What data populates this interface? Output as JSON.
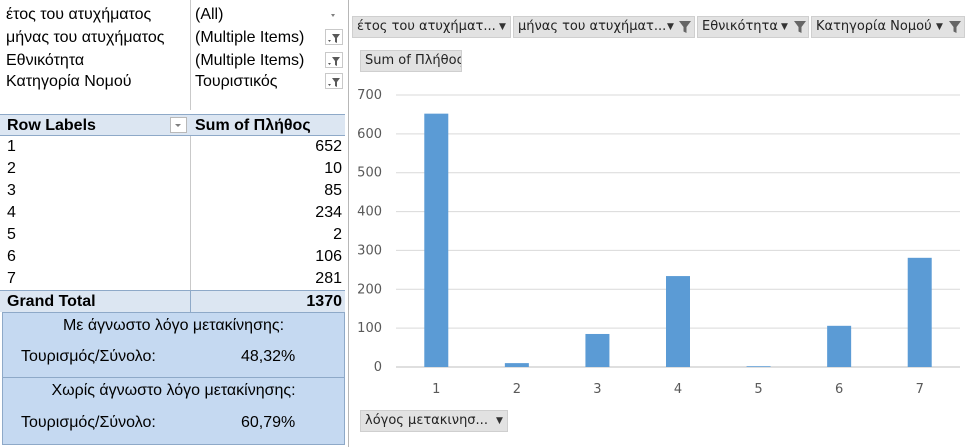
{
  "filters": [
    {
      "name": "έτος του ατυχήματος",
      "value": "(All)",
      "icon": "dropdown-arrow-icon"
    },
    {
      "name": "μήνας του ατυχήματος",
      "value": "(Multiple Items)",
      "icon": "filter-funnel-icon"
    },
    {
      "name": "Εθνικότητα",
      "value": "(Multiple Items)",
      "icon": "filter-funnel-icon"
    },
    {
      "name": "Κατηγορία Νομού",
      "value": "Τουριστικός",
      "icon": "filter-funnel-icon"
    }
  ],
  "table": {
    "header_labels": "Row Labels",
    "header_values": "Sum of Πλήθος",
    "rows": [
      {
        "label": "1",
        "value": "652"
      },
      {
        "label": "2",
        "value": "10"
      },
      {
        "label": "3",
        "value": "85"
      },
      {
        "label": "4",
        "value": "234"
      },
      {
        "label": "5",
        "value": "2"
      },
      {
        "label": "6",
        "value": "106"
      },
      {
        "label": "7",
        "value": "281"
      }
    ],
    "total_label": "Grand Total",
    "total_value": "1370"
  },
  "notes": {
    "unknown_title": "Με άγνωστο λόγο μετακίνησης:",
    "unknown_label": "Τουρισμός/Σύνολο:",
    "unknown_value": "48,32%",
    "known_title": "Χωρίς άγνωστο λόγο μετακίνησης:",
    "known_label": "Τουρισμός/Σύνολο:",
    "known_value": "60,79%"
  },
  "chart_filters": [
    {
      "label": "έτος του ατυχήματ...",
      "icon": "dropdown-arrow-icon"
    },
    {
      "label": "μήνας του ατυχήματ...",
      "icon": "filter-funnel-icon"
    },
    {
      "label": "Εθνικότητα",
      "icon": "filter-funnel-icon"
    },
    {
      "label": "Κατηγορία Νομού",
      "icon": "filter-funnel-icon"
    }
  ],
  "chart_value_field": "Sum of Πλήθος",
  "chart_axis_field": "λόγος μετακινησ...",
  "colors": {
    "bar": "#5b9bd5",
    "header_fill": "#dce6f2",
    "note_fill": "#c5d9f1"
  },
  "chart_data": {
    "type": "bar",
    "categories": [
      "1",
      "2",
      "3",
      "4",
      "5",
      "6",
      "7"
    ],
    "values": [
      652,
      10,
      85,
      234,
      2,
      106,
      281
    ],
    "title": "",
    "xlabel": "",
    "ylabel": "",
    "ylim": [
      0,
      700
    ],
    "yticks": [
      0,
      100,
      200,
      300,
      400,
      500,
      600,
      700
    ],
    "grid": true,
    "legend": "none"
  }
}
